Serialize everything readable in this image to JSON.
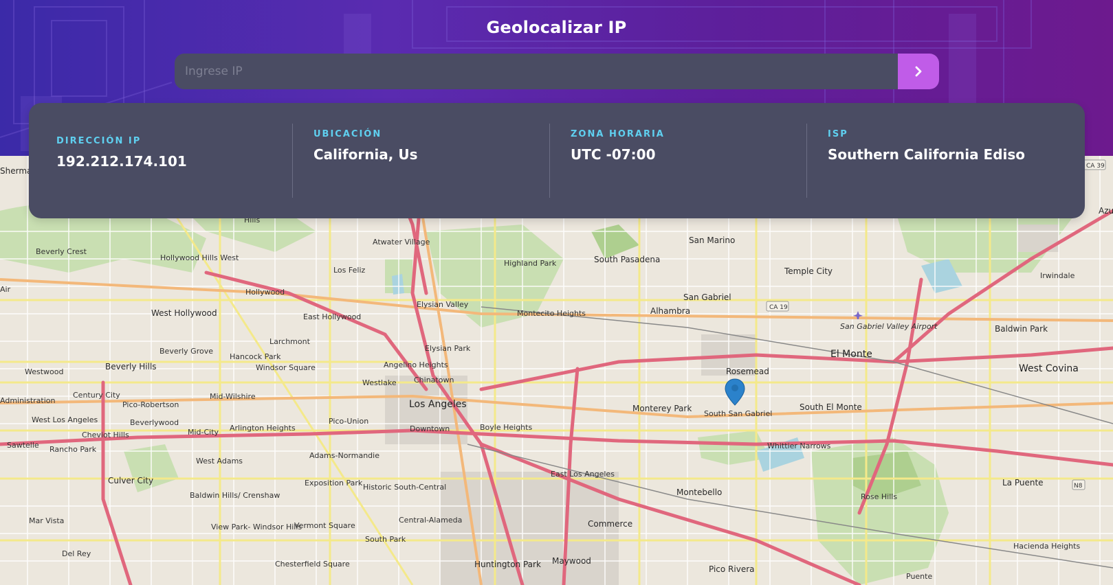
{
  "header": {
    "title": "Geolocalizar IP",
    "search_placeholder": "Ingrese IP",
    "search_value": "",
    "submit_icon": "chevron-right-icon"
  },
  "info": {
    "ip": {
      "label": "DIRECCIÓN IP",
      "value": "192.212.174.101"
    },
    "location": {
      "label": "UBICACIÓN",
      "value": "California, Us"
    },
    "timezone": {
      "label": "ZONA HORARIA",
      "value": "UTC -07:00"
    },
    "isp": {
      "label": "ISP",
      "value": "Southern California Ediso"
    }
  },
  "map": {
    "marker_icon": "map-pin-icon",
    "places": [
      "Sherman",
      "Hills",
      "Beverly Crest",
      "Hollywood Hills West",
      "Atwater Village",
      "Highland Park",
      "South Pasadena",
      "San Marino",
      "Temple City",
      "Irwindale",
      "Los Feliz",
      "Hollywood",
      "West Hollywood",
      "East Hollywood",
      "Elysian Valley",
      "Montecito Heights",
      "Alhambra",
      "San Gabriel",
      "Baldwin Park",
      "Larchmont",
      "Beverly Grove",
      "Hancock Park",
      "Windsor Square",
      "Elysian Park",
      "Angelino Heights",
      "El Monte",
      "Rosemead",
      "West Covina",
      "Westwood",
      "Beverly Hills",
      "Chinatown",
      "Westlake",
      "Los Angeles",
      "Century City",
      "Mid-Wilshire",
      "Pico-Robertson",
      "Monterey Park",
      "South San Gabriel",
      "South El Monte",
      "Administration",
      "West Los Angeles",
      "Beverlywood",
      "Cheviot Hills",
      "Mid-City",
      "Arlington Heights",
      "Pico-Union",
      "Downtown",
      "Boyle Heights",
      "Sawtelle",
      "Rancho Park",
      "Whittier Narrows",
      "Adams-Normandie",
      "East Los Angeles",
      "West Adams",
      "Culver City",
      "Exposition Park",
      "Historic South-Central",
      "Montebello",
      "Rose Hills",
      "La Puente",
      "Baldwin Hills/ Crenshaw",
      "Mar Vista",
      "Vermont Square",
      "View Park- Windsor Hills",
      "Central-Alameda",
      "Commerce",
      "South Park",
      "Del Rey",
      "Chesterfield Square",
      "Huntington Park",
      "Maywood",
      "Pico Rivera",
      "Hacienda Heights",
      "Air",
      "San Gabriel Valley Airport",
      "Puente",
      "Azu"
    ]
  }
}
